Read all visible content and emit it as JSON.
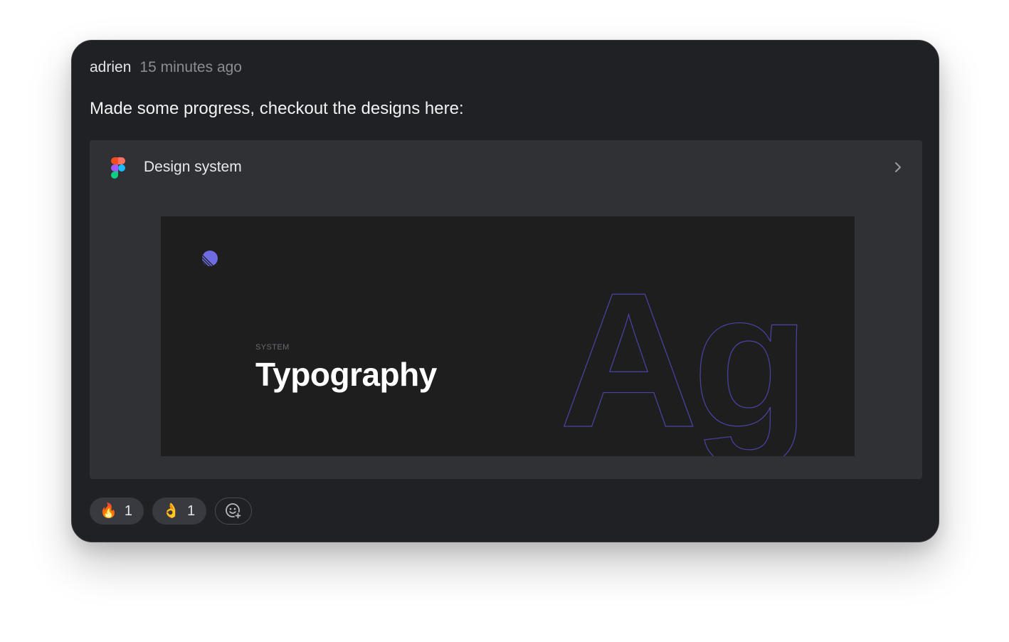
{
  "message": {
    "author": "adrien",
    "timestamp": "15 minutes ago",
    "text": "Made some progress, checkout the designs here:"
  },
  "attachment": {
    "source_icon": "figma-icon",
    "title": "Design system",
    "open_icon": "chevron-right-icon",
    "preview": {
      "eyebrow": "SYSTEM",
      "title": "Typography",
      "glyph_sample": "Ag",
      "logo_icon": "linear-logo-icon"
    }
  },
  "reactions": [
    {
      "emoji": "🔥",
      "count": "1",
      "icon": "fire-emoji"
    },
    {
      "emoji": "👌",
      "count": "1",
      "icon": "ok-hand-emoji"
    }
  ],
  "add_reaction_icon": "add-emoji-icon",
  "colors": {
    "card_bg": "#202124",
    "attachment_bg": "#303135",
    "preview_bg": "#1e1e1f",
    "accent_purple": "#5e5ce6",
    "reaction_bg": "#393a40"
  }
}
